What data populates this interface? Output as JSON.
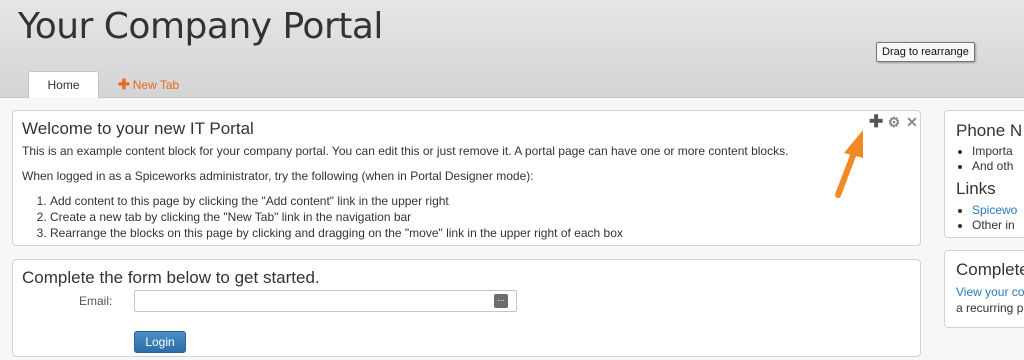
{
  "header": {
    "title": "Your Company Portal",
    "tabs": [
      {
        "label": "Home"
      },
      {
        "label": "New Tab",
        "icon": "plus-icon"
      }
    ]
  },
  "welcome_block": {
    "title": "Welcome to your new IT Portal",
    "paragraph1": "This is an example content block for your company portal. You can edit this or just remove it. A portal page can have one or more content blocks.",
    "paragraph2": "When logged in as a Spiceworks administrator, try the following (when in Portal Designer mode):",
    "steps": [
      "Add content to this page by clicking the \"Add content\" link in the upper right",
      "Create a new tab by clicking the \"New Tab\" link in the navigation bar",
      "Rearrange the blocks on this page by clicking and dragging on the \"move\" link in the upper right of each box"
    ],
    "tools": {
      "move": "✚",
      "settings": "⚙",
      "close": "✕"
    },
    "tooltip": "Drag to rearrange"
  },
  "form_block": {
    "title": "Complete the form below to get started.",
    "email_label": "Email:",
    "email_value": "",
    "login_label": "Login"
  },
  "sidebar_phone": {
    "title": "Phone N",
    "items": [
      "Importa",
      "And oth"
    ],
    "links_title": "Links",
    "links": [
      "Spicewo",
      "Other in"
    ]
  },
  "sidebar_complete": {
    "title": "Complete",
    "link": "View your co",
    "text": "a recurring p"
  },
  "colors": {
    "accent_orange": "#e8681e",
    "link_blue": "#2a7ab8",
    "button_blue": "#3a7dba"
  }
}
